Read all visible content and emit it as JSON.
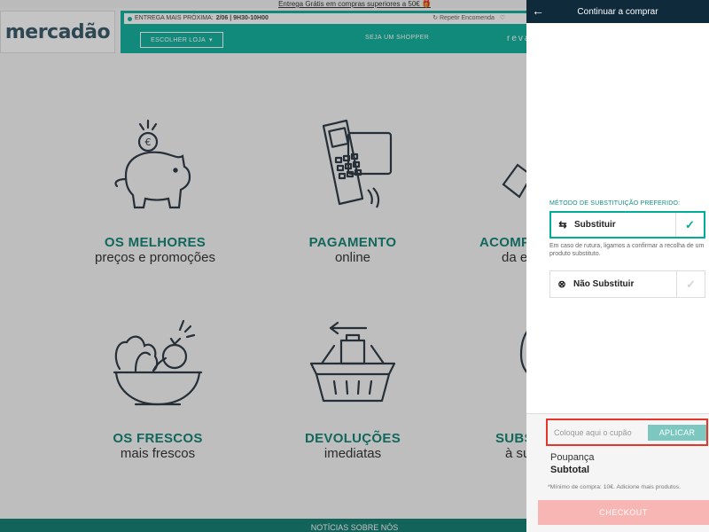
{
  "promo": {
    "text": "Entrega Grátis em compras superiores a 50€ 🎁"
  },
  "header": {
    "logo": "mercadão",
    "delivery_label": "ENTREGA MAIS PRÓXIMA:",
    "delivery_value": "2/06 | 9H30-10H00",
    "repeat_order": "Repetir Encomenda",
    "store_button": "ESCOLHER LOJA",
    "shopper_link": "SEJA UM SHOPPER",
    "partial_text": "reva"
  },
  "features": [
    {
      "title": "OS MELHORES",
      "subtitle": "preços e promoções",
      "icon": "piggy-bank-icon"
    },
    {
      "title": "PAGAMENTO",
      "subtitle": "online",
      "icon": "card-terminal-icon"
    },
    {
      "title": "ACOMP",
      "subtitle": "da e",
      "icon": "delivery-icon"
    },
    {
      "title": "OS FRESCOS",
      "subtitle": "mais frescos",
      "icon": "vegetable-bowl-icon"
    },
    {
      "title": "DEVOLUÇÕES",
      "subtitle": "imediatas",
      "icon": "basket-return-icon"
    },
    {
      "title": "SUBS",
      "subtitle": "à su",
      "icon": "substitution-icon"
    }
  ],
  "footer": {
    "text": "NOTÍCIAS SOBRE NÓS"
  },
  "panel": {
    "title": "Continuar a comprar",
    "section_label": "MÉTODO DE SUBSTITUIÇÃO PREFERIDO:",
    "option1": {
      "label": "Substituir",
      "icon": "swap-arrows-icon",
      "selected": true
    },
    "option1_hint": "Em caso de rutura, ligamos a confirmar a recolha de um produto substituto.",
    "option2": {
      "label": "Não Substituir",
      "icon": "circle-x-icon",
      "selected": false
    },
    "coupon_placeholder": "Coloque aqui o cupão",
    "apply_label": "APLICAR",
    "savings_label": "Poupança",
    "subtotal_label": "Subtotal",
    "min_note": "*Mínimo de compra: 10€. Adicione mais produtos.",
    "checkout_label": "CHECKOUT"
  },
  "colors": {
    "brand_green": "#00ad97",
    "dark_navy": "#0f2a3b",
    "highlight_red": "#e8352c",
    "checkout_pink": "#f7b6b4"
  }
}
